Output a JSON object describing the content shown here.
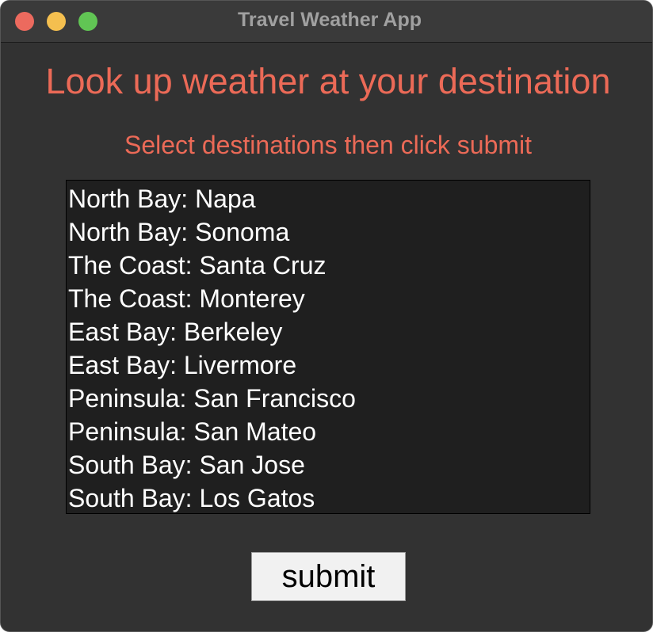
{
  "window": {
    "title": "Travel Weather App"
  },
  "main": {
    "heading": "Look up weather at your destination",
    "subheading": "Select destinations then click submit",
    "destinations": [
      "North Bay: Napa",
      "North Bay: Sonoma",
      "The Coast: Santa Cruz",
      "The Coast: Monterey",
      "East Bay: Berkeley",
      "East Bay: Livermore",
      "Peninsula: San Francisco",
      "Peninsula: San Mateo",
      "South Bay: San Jose",
      "South Bay: Los Gatos"
    ],
    "submit_label": "submit"
  },
  "colors": {
    "window_background": "#323232",
    "accent_text": "#ec6a57",
    "listbox_background": "#1f1f1f",
    "list_text": "#ffffff"
  },
  "icons": {
    "close": "close-icon",
    "minimize": "minimize-icon",
    "maximize": "maximize-icon"
  }
}
